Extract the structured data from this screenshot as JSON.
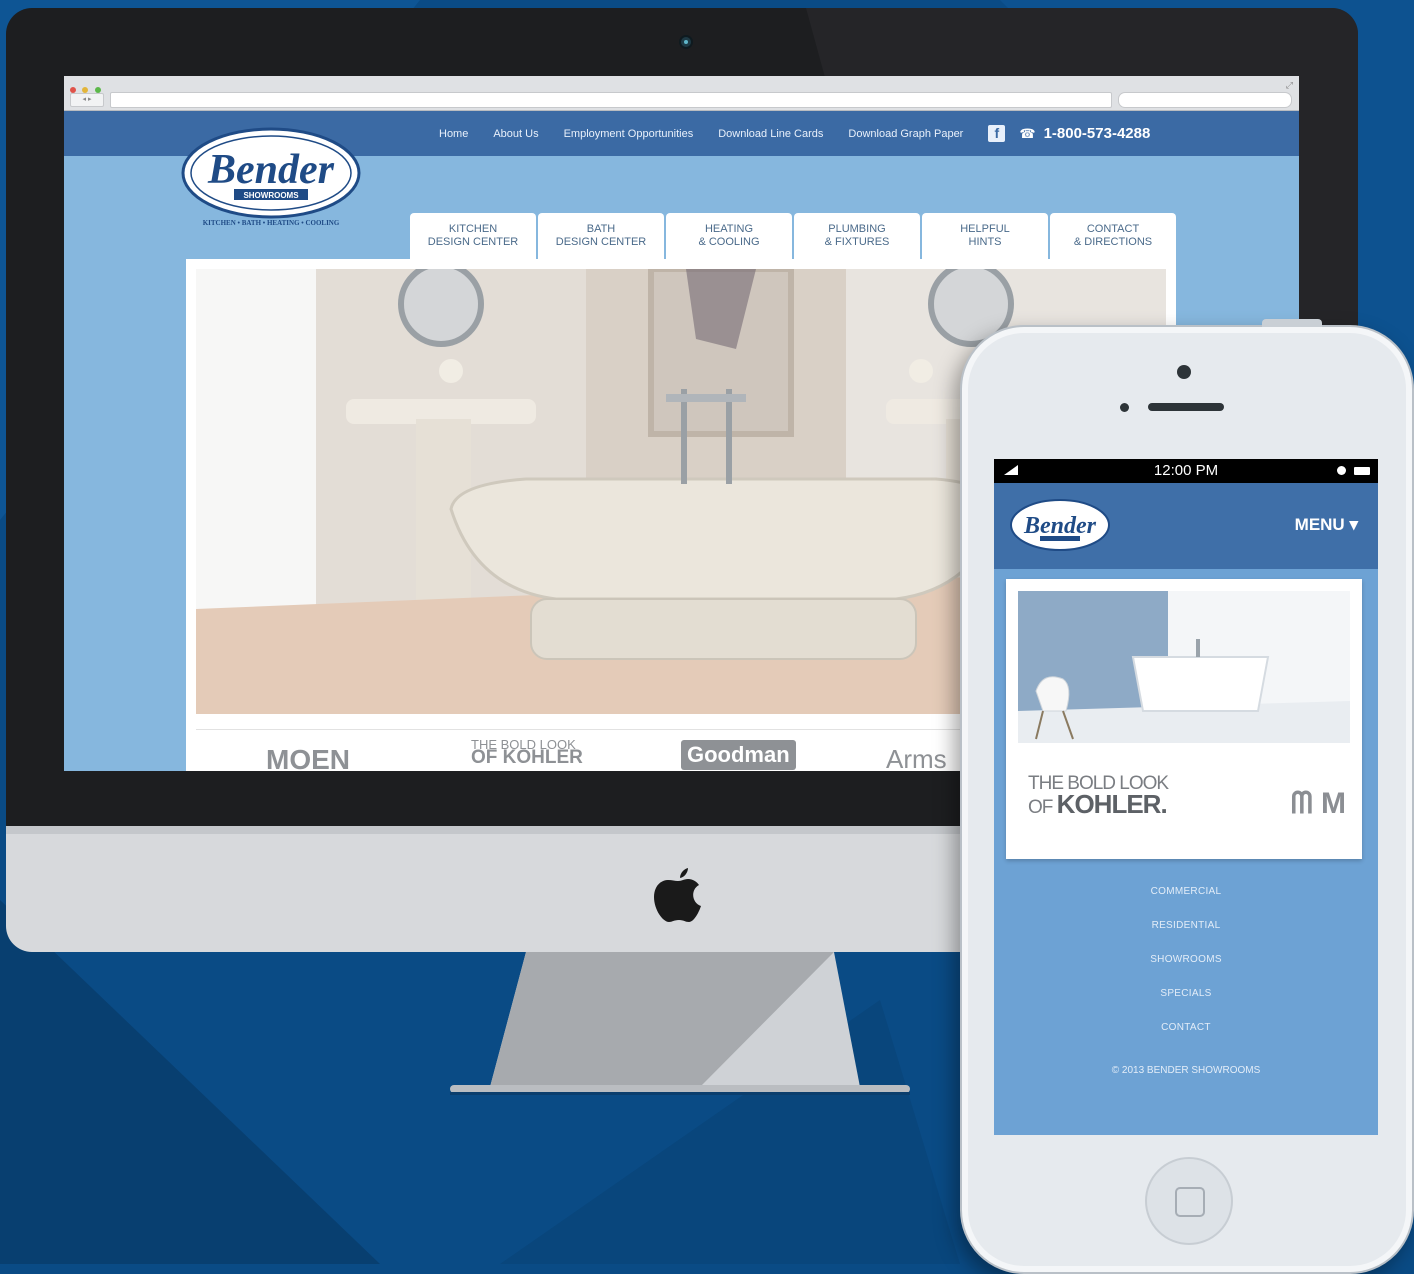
{
  "site": {
    "topnav": [
      "Home",
      "About Us",
      "Employment Opportunities",
      "Download Line Cards",
      "Download Graph Paper"
    ],
    "facebook_label": "f",
    "phone": "1-800-573-4288",
    "logo": {
      "name": "Bender",
      "sub": "SHOWROOMS",
      "tagline": "KITCHEN • BATH • HEATING • COOLING"
    },
    "tabs": [
      "KITCHEN\nDESIGN CENTER",
      "BATH\nDESIGN CENTER",
      "HEATING\n& COOLING",
      "PLUMBING\n& FIXTURES",
      "HELPFUL\nHINTS",
      "CONTACT\n& DIRECTIONS"
    ],
    "brands": {
      "moen": "MOEN",
      "kohler_top": "THE BOLD LOOK",
      "kohler_bottom": "OF KOHLER",
      "goodman": "Goodman",
      "armstrong": "Arms"
    }
  },
  "mobile": {
    "time": "12:00 PM",
    "menu": "MENU",
    "logo": "Bender",
    "kohler_top": "THE BOLD LOOK",
    "kohler_of": "OF",
    "kohler_name": "KOHLER.",
    "moen": "M",
    "links": [
      "COMMERCIAL",
      "RESIDENTIAL",
      "SHOWROOMS",
      "SPECIALS",
      "CONTACT"
    ],
    "footer": "© 2013 BENDER SHOWROOMS"
  },
  "colors": {
    "background": "#0a4b85",
    "nav_bar": "#3b6aa4",
    "site_bg": "#86b7de",
    "mobile_bg": "#6da2d4"
  }
}
